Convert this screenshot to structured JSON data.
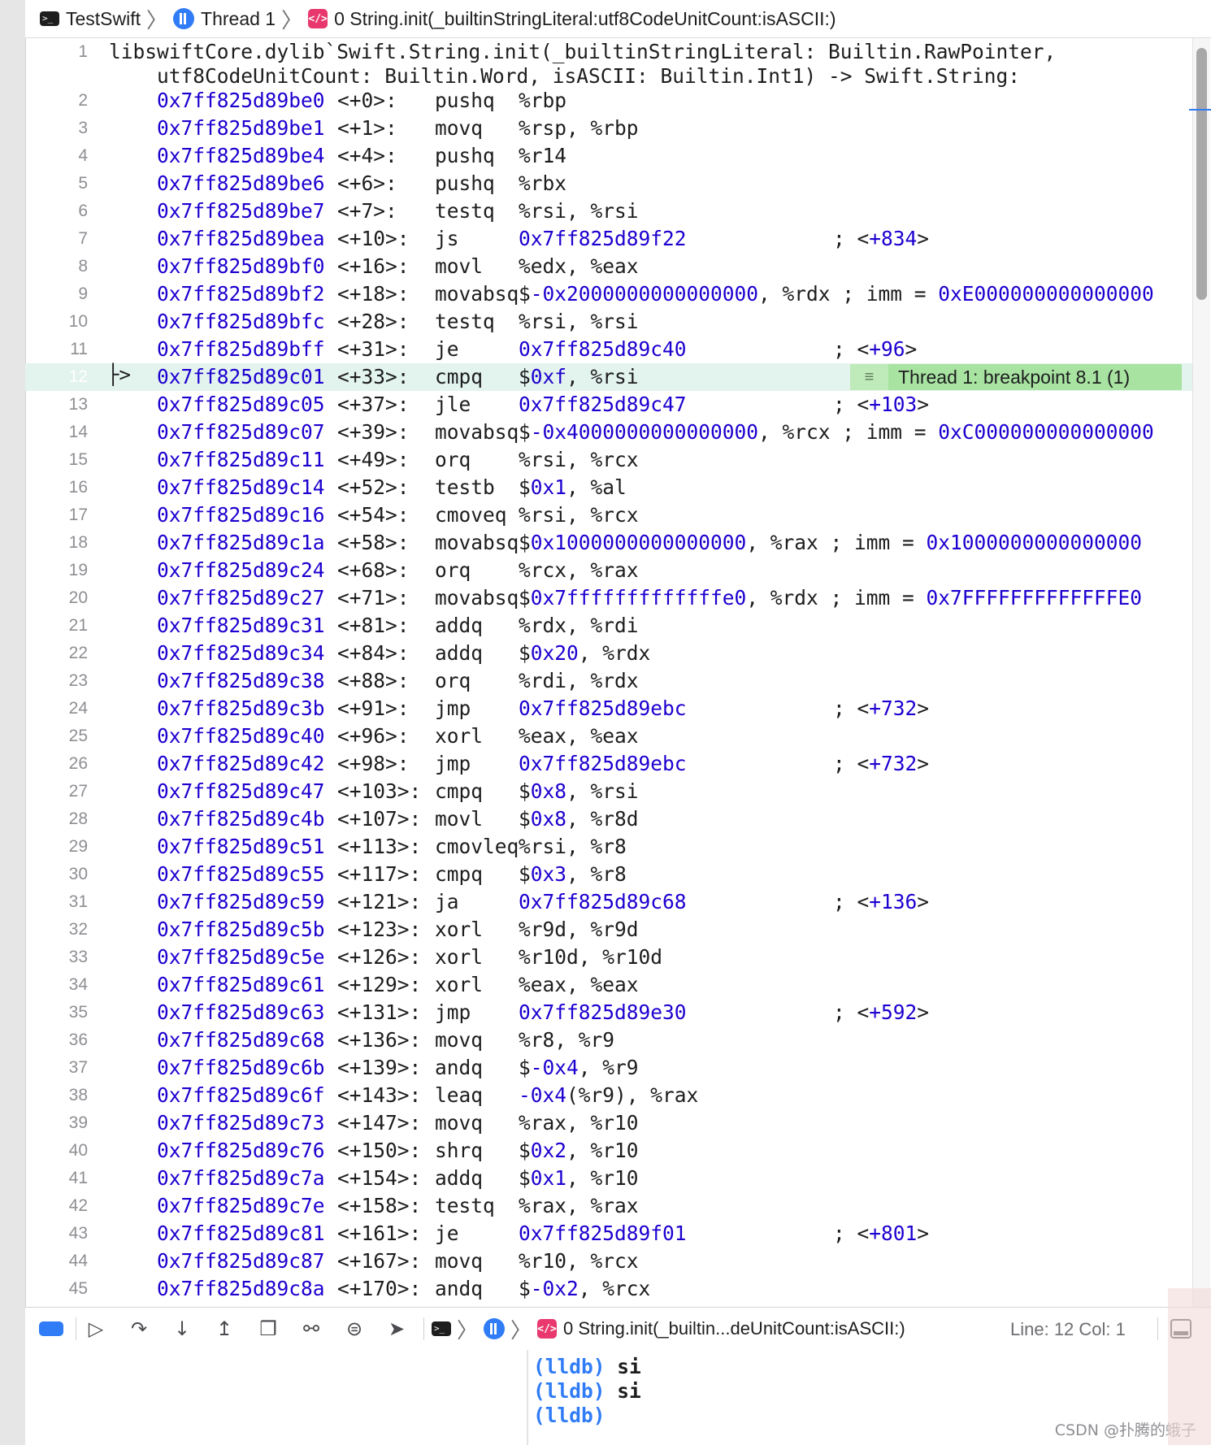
{
  "jumpbar": {
    "project": "TestSwift",
    "thread": "Thread 1",
    "frame": "0 String.init(_builtinStringLiteral:utf8CodeUnitCount:isASCII:)"
  },
  "disasm": {
    "header_line_number": "1",
    "header_line1": "libswiftCore.dylib`Swift.String.init(_builtinStringLiteral: Builtin.RawPointer,",
    "header_line2": "utf8CodeUnitCount: Builtin.Word, isASCII: Builtin.Int1) -> Swift.String:",
    "current_marker": "├>",
    "rows": [
      {
        "n": "2",
        "addr": "0x7ff825d89be0",
        "off": "<+0>:",
        "mn": "pushq",
        "op": [
          [
            "t",
            "%rbp"
          ]
        ],
        "cm": []
      },
      {
        "n": "3",
        "addr": "0x7ff825d89be1",
        "off": "<+1>:",
        "mn": "movq",
        "op": [
          [
            "t",
            "%rsp, %rbp"
          ]
        ],
        "cm": []
      },
      {
        "n": "4",
        "addr": "0x7ff825d89be4",
        "off": "<+4>:",
        "mn": "pushq",
        "op": [
          [
            "t",
            "%r14"
          ]
        ],
        "cm": []
      },
      {
        "n": "5",
        "addr": "0x7ff825d89be6",
        "off": "<+6>:",
        "mn": "pushq",
        "op": [
          [
            "t",
            "%rbx"
          ]
        ],
        "cm": []
      },
      {
        "n": "6",
        "addr": "0x7ff825d89be7",
        "off": "<+7>:",
        "mn": "testq",
        "op": [
          [
            "t",
            "%rsi, %rsi"
          ]
        ],
        "cm": []
      },
      {
        "n": "7",
        "addr": "0x7ff825d89bea",
        "off": "<+10>:",
        "mn": "js",
        "op": [
          [
            "n",
            "0x7ff825d89f22"
          ]
        ],
        "cm": [
          [
            "t",
            "; <"
          ],
          [
            "n",
            "+834"
          ],
          [
            "t",
            ">"
          ]
        ]
      },
      {
        "n": "8",
        "addr": "0x7ff825d89bf0",
        "off": "<+16>:",
        "mn": "movl",
        "op": [
          [
            "t",
            "%edx, %eax"
          ]
        ],
        "cm": []
      },
      {
        "n": "9",
        "addr": "0x7ff825d89bf2",
        "off": "<+18>:",
        "mn": "movabsq",
        "op": [
          [
            "t",
            "$"
          ],
          [
            "n",
            "-0x2000000000000000"
          ],
          [
            "t",
            ", %rdx ; imm = "
          ],
          [
            "n",
            "0xE000000000000000"
          ]
        ],
        "cm": []
      },
      {
        "n": "10",
        "addr": "0x7ff825d89bfc",
        "off": "<+28>:",
        "mn": "testq",
        "op": [
          [
            "t",
            "%rsi, %rsi"
          ]
        ],
        "cm": []
      },
      {
        "n": "11",
        "addr": "0x7ff825d89bff",
        "off": "<+31>:",
        "mn": "je",
        "op": [
          [
            "n",
            "0x7ff825d89c40"
          ]
        ],
        "cm": [
          [
            "t",
            "; <"
          ],
          [
            "n",
            "+96"
          ],
          [
            "t",
            ">"
          ]
        ]
      },
      {
        "n": "12",
        "addr": "0x7ff825d89c01",
        "off": "<+33>:",
        "mn": "cmpq",
        "op": [
          [
            "t",
            "$"
          ],
          [
            "n",
            "0xf"
          ],
          [
            "t",
            ", %rsi"
          ]
        ],
        "cm": [],
        "current": true
      },
      {
        "n": "13",
        "addr": "0x7ff825d89c05",
        "off": "<+37>:",
        "mn": "jle",
        "op": [
          [
            "n",
            "0x7ff825d89c47"
          ]
        ],
        "cm": [
          [
            "t",
            "; <"
          ],
          [
            "n",
            "+103"
          ],
          [
            "t",
            ">"
          ]
        ]
      },
      {
        "n": "14",
        "addr": "0x7ff825d89c07",
        "off": "<+39>:",
        "mn": "movabsq",
        "op": [
          [
            "t",
            "$"
          ],
          [
            "n",
            "-0x4000000000000000"
          ],
          [
            "t",
            ", %rcx ; imm = "
          ],
          [
            "n",
            "0xC000000000000000"
          ]
        ],
        "cm": []
      },
      {
        "n": "15",
        "addr": "0x7ff825d89c11",
        "off": "<+49>:",
        "mn": "orq",
        "op": [
          [
            "t",
            "%rsi, %rcx"
          ]
        ],
        "cm": []
      },
      {
        "n": "16",
        "addr": "0x7ff825d89c14",
        "off": "<+52>:",
        "mn": "testb",
        "op": [
          [
            "t",
            "$"
          ],
          [
            "n",
            "0x1"
          ],
          [
            "t",
            ", %al"
          ]
        ],
        "cm": []
      },
      {
        "n": "17",
        "addr": "0x7ff825d89c16",
        "off": "<+54>:",
        "mn": "cmoveq",
        "op": [
          [
            "t",
            "%rsi, %rcx"
          ]
        ],
        "cm": []
      },
      {
        "n": "18",
        "addr": "0x7ff825d89c1a",
        "off": "<+58>:",
        "mn": "movabsq",
        "op": [
          [
            "t",
            "$"
          ],
          [
            "n",
            "0x1000000000000000"
          ],
          [
            "t",
            ", %rax ; imm = "
          ],
          [
            "n",
            "0x1000000000000000"
          ]
        ],
        "cm": []
      },
      {
        "n": "19",
        "addr": "0x7ff825d89c24",
        "off": "<+68>:",
        "mn": "orq",
        "op": [
          [
            "t",
            "%rcx, %rax"
          ]
        ],
        "cm": []
      },
      {
        "n": "20",
        "addr": "0x7ff825d89c27",
        "off": "<+71>:",
        "mn": "movabsq",
        "op": [
          [
            "t",
            "$"
          ],
          [
            "n",
            "0x7fffffffffffffe0"
          ],
          [
            "t",
            ", %rdx ; imm = "
          ],
          [
            "n",
            "0x7FFFFFFFFFFFFFE0"
          ]
        ],
        "cm": []
      },
      {
        "n": "21",
        "addr": "0x7ff825d89c31",
        "off": "<+81>:",
        "mn": "addq",
        "op": [
          [
            "t",
            "%rdx, %rdi"
          ]
        ],
        "cm": []
      },
      {
        "n": "22",
        "addr": "0x7ff825d89c34",
        "off": "<+84>:",
        "mn": "addq",
        "op": [
          [
            "t",
            "$"
          ],
          [
            "n",
            "0x20"
          ],
          [
            "t",
            ", %rdx"
          ]
        ],
        "cm": []
      },
      {
        "n": "23",
        "addr": "0x7ff825d89c38",
        "off": "<+88>:",
        "mn": "orq",
        "op": [
          [
            "t",
            "%rdi, %rdx"
          ]
        ],
        "cm": []
      },
      {
        "n": "24",
        "addr": "0x7ff825d89c3b",
        "off": "<+91>:",
        "mn": "jmp",
        "op": [
          [
            "n",
            "0x7ff825d89ebc"
          ]
        ],
        "cm": [
          [
            "t",
            "; <"
          ],
          [
            "n",
            "+732"
          ],
          [
            "t",
            ">"
          ]
        ]
      },
      {
        "n": "25",
        "addr": "0x7ff825d89c40",
        "off": "<+96>:",
        "mn": "xorl",
        "op": [
          [
            "t",
            "%eax, %eax"
          ]
        ],
        "cm": []
      },
      {
        "n": "26",
        "addr": "0x7ff825d89c42",
        "off": "<+98>:",
        "mn": "jmp",
        "op": [
          [
            "n",
            "0x7ff825d89ebc"
          ]
        ],
        "cm": [
          [
            "t",
            "; <"
          ],
          [
            "n",
            "+732"
          ],
          [
            "t",
            ">"
          ]
        ]
      },
      {
        "n": "27",
        "addr": "0x7ff825d89c47",
        "off": "<+103>:",
        "mn": "cmpq",
        "op": [
          [
            "t",
            "$"
          ],
          [
            "n",
            "0x8"
          ],
          [
            "t",
            ", %rsi"
          ]
        ],
        "cm": []
      },
      {
        "n": "28",
        "addr": "0x7ff825d89c4b",
        "off": "<+107>:",
        "mn": "movl",
        "op": [
          [
            "t",
            "$"
          ],
          [
            "n",
            "0x8"
          ],
          [
            "t",
            ", %r8d"
          ]
        ],
        "cm": []
      },
      {
        "n": "29",
        "addr": "0x7ff825d89c51",
        "off": "<+113>:",
        "mn": "cmovleq",
        "op": [
          [
            "t",
            "%rsi, %r8"
          ]
        ],
        "cm": []
      },
      {
        "n": "30",
        "addr": "0x7ff825d89c55",
        "off": "<+117>:",
        "mn": "cmpq",
        "op": [
          [
            "t",
            "$"
          ],
          [
            "n",
            "0x3"
          ],
          [
            "t",
            ", %r8"
          ]
        ],
        "cm": []
      },
      {
        "n": "31",
        "addr": "0x7ff825d89c59",
        "off": "<+121>:",
        "mn": "ja",
        "op": [
          [
            "n",
            "0x7ff825d89c68"
          ]
        ],
        "cm": [
          [
            "t",
            "; <"
          ],
          [
            "n",
            "+136"
          ],
          [
            "t",
            ">"
          ]
        ]
      },
      {
        "n": "32",
        "addr": "0x7ff825d89c5b",
        "off": "<+123>:",
        "mn": "xorl",
        "op": [
          [
            "t",
            "%r9d, %r9d"
          ]
        ],
        "cm": []
      },
      {
        "n": "33",
        "addr": "0x7ff825d89c5e",
        "off": "<+126>:",
        "mn": "xorl",
        "op": [
          [
            "t",
            "%r10d, %r10d"
          ]
        ],
        "cm": []
      },
      {
        "n": "34",
        "addr": "0x7ff825d89c61",
        "off": "<+129>:",
        "mn": "xorl",
        "op": [
          [
            "t",
            "%eax, %eax"
          ]
        ],
        "cm": []
      },
      {
        "n": "35",
        "addr": "0x7ff825d89c63",
        "off": "<+131>:",
        "mn": "jmp",
        "op": [
          [
            "n",
            "0x7ff825d89e30"
          ]
        ],
        "cm": [
          [
            "t",
            "; <"
          ],
          [
            "n",
            "+592"
          ],
          [
            "t",
            ">"
          ]
        ]
      },
      {
        "n": "36",
        "addr": "0x7ff825d89c68",
        "off": "<+136>:",
        "mn": "movq",
        "op": [
          [
            "t",
            "%r8, %r9"
          ]
        ],
        "cm": []
      },
      {
        "n": "37",
        "addr": "0x7ff825d89c6b",
        "off": "<+139>:",
        "mn": "andq",
        "op": [
          [
            "t",
            "$"
          ],
          [
            "n",
            "-0x4"
          ],
          [
            "t",
            ", %r9"
          ]
        ],
        "cm": []
      },
      {
        "n": "38",
        "addr": "0x7ff825d89c6f",
        "off": "<+143>:",
        "mn": "leaq",
        "op": [
          [
            "n",
            "-0x4"
          ],
          [
            "t",
            "(%r9), %rax"
          ]
        ],
        "cm": []
      },
      {
        "n": "39",
        "addr": "0x7ff825d89c73",
        "off": "<+147>:",
        "mn": "movq",
        "op": [
          [
            "t",
            "%rax, %r10"
          ]
        ],
        "cm": []
      },
      {
        "n": "40",
        "addr": "0x7ff825d89c76",
        "off": "<+150>:",
        "mn": "shrq",
        "op": [
          [
            "t",
            "$"
          ],
          [
            "n",
            "0x2"
          ],
          [
            "t",
            ", %r10"
          ]
        ],
        "cm": []
      },
      {
        "n": "41",
        "addr": "0x7ff825d89c7a",
        "off": "<+154>:",
        "mn": "addq",
        "op": [
          [
            "t",
            "$"
          ],
          [
            "n",
            "0x1"
          ],
          [
            "t",
            ", %r10"
          ]
        ],
        "cm": []
      },
      {
        "n": "42",
        "addr": "0x7ff825d89c7e",
        "off": "<+158>:",
        "mn": "testq",
        "op": [
          [
            "t",
            "%rax, %rax"
          ]
        ],
        "cm": []
      },
      {
        "n": "43",
        "addr": "0x7ff825d89c81",
        "off": "<+161>:",
        "mn": "je",
        "op": [
          [
            "n",
            "0x7ff825d89f01"
          ]
        ],
        "cm": [
          [
            "t",
            "; <"
          ],
          [
            "n",
            "+801"
          ],
          [
            "t",
            ">"
          ]
        ]
      },
      {
        "n": "44",
        "addr": "0x7ff825d89c87",
        "off": "<+167>:",
        "mn": "movq",
        "op": [
          [
            "t",
            "%r10, %rcx"
          ]
        ],
        "cm": []
      },
      {
        "n": "45",
        "addr": "0x7ff825d89c8a",
        "off": "<+170>:",
        "mn": "andq",
        "op": [
          [
            "t",
            "$"
          ],
          [
            "n",
            "-0x2"
          ],
          [
            "t",
            ", %rcx"
          ]
        ],
        "cm": []
      }
    ]
  },
  "breakpoint_annotation": {
    "line": "12",
    "text": "Thread 1: breakpoint 8.1 (1)"
  },
  "debug_bar": {
    "frame": "0 String.init(_builtin...deUnitCount:isASCII:)",
    "line_col": "Line: 12  Col: 1"
  },
  "console": {
    "lines": [
      {
        "prompt": "(lldb)",
        "command": "si"
      },
      {
        "prompt": "(lldb)",
        "command": "si"
      },
      {
        "prompt": "(lldb)",
        "command": ""
      }
    ]
  },
  "watermark": "CSDN @扑腾的蛾子",
  "colors": {
    "number_blue": "#1c00cf",
    "current_line_bg": "#e3f3ee",
    "breakpoint_green": "#a8e3a1",
    "accent_blue": "#2f7cf6",
    "frame_pink": "#e8386e"
  },
  "icons": [
    "terminal-icon",
    "thread-icon",
    "stack-frame-icon",
    "breakpoints-toggle-icon",
    "continue-icon",
    "step-over-icon",
    "step-into-icon",
    "step-out-icon",
    "view-hierarchy-icon",
    "memory-graph-icon",
    "environment-overrides-icon",
    "location-icon",
    "hide-console-icon"
  ]
}
